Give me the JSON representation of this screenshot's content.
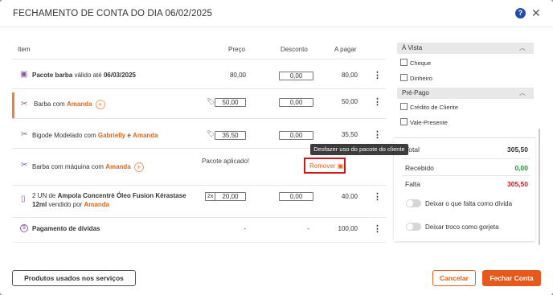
{
  "title": "FECHAMENTO DE CONTA DO DIA 06/02/2025",
  "columns": {
    "item": "Item",
    "preco": "Preço",
    "desconto": "Desconto",
    "apagar": "A pagar"
  },
  "rows": [
    {
      "name": "Pacote barba",
      "note": "válido até",
      "date": "06/03/2025",
      "preco": "80,00",
      "desconto": "0,00",
      "apagar": "80,00"
    },
    {
      "name": "Barba",
      "com": "com",
      "prof": "Amanda",
      "preco": "50,00",
      "desconto": "0,00",
      "apagar": "50,00"
    },
    {
      "name": "Bigode Modelado",
      "com": "com",
      "prof1": "Gabrielly",
      "e": "e",
      "prof2": "Amanda",
      "preco": "35,50",
      "desconto": "0,00",
      "apagar": "35,50"
    },
    {
      "name": "Barba com máquina",
      "com": "com",
      "prof": "Amanda",
      "pacote": "Pacote aplicado!",
      "remover": "Remover"
    },
    {
      "qty_prefix": "2 UN de",
      "name": "Ampola Concentrè Óleo Fusion Kérastase",
      "line2": "12ml",
      "vendido": "vendido por",
      "prof": "Amanda",
      "qty": "2x",
      "preco": "20,00",
      "desconto": "0,00",
      "apagar": "40,00"
    },
    {
      "name": "Pagamento de dívidas",
      "preco": "-",
      "desconto": "-",
      "apagar": "100,00"
    }
  ],
  "tooltip": "Desfazer uso do pacote do cliente",
  "payment": {
    "avista": "À Vista",
    "avista_options": [
      "Cheque",
      "Dinheiro"
    ],
    "prepago": "Pré-Pago",
    "prepago_options": [
      "Crédito de Cliente",
      "Vale-Presente"
    ]
  },
  "summary": {
    "total_label": "Total",
    "total": "305,50",
    "recebido_label": "Recebido",
    "recebido": "0,00",
    "falta_label": "Falta",
    "falta": "305,50",
    "toggle1": "Deixar o que falta como dívida",
    "toggle2": "Deixar troco como gorjeta"
  },
  "buttons": {
    "produtos": "Produtos usados nos serviços",
    "cancelar": "Cancelar",
    "fechar": "Fechar Conta"
  },
  "colors": {
    "accent": "#e8581a",
    "green": "#1a9a2a",
    "red": "#d0161b",
    "purple": "#8b5aa8"
  }
}
